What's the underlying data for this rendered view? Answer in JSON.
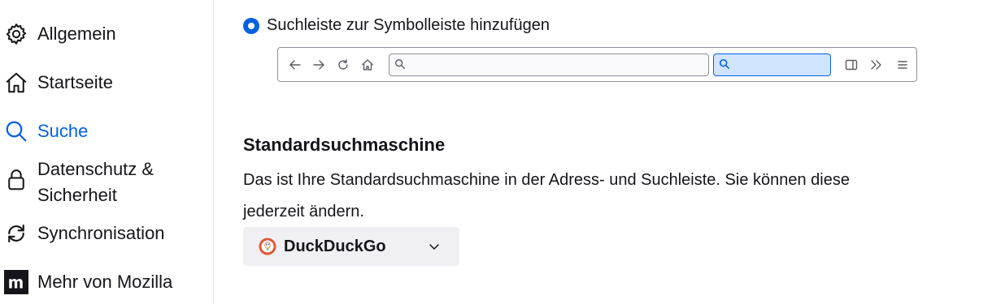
{
  "sidebar": {
    "items": [
      {
        "label": "Allgemein",
        "icon": "gear-icon"
      },
      {
        "label": "Startseite",
        "icon": "home-icon"
      },
      {
        "label": "Suche",
        "icon": "search-icon",
        "active": true
      },
      {
        "label": "Datenschutz &",
        "label2": "Sicherheit",
        "icon": "lock-icon"
      },
      {
        "label": "Synchronisation",
        "icon": "sync-icon"
      },
      {
        "label": "Mehr von Mozilla",
        "icon": "mozilla-icon"
      }
    ]
  },
  "main": {
    "radio_label": "Suchleiste zur Symbolleiste hinzufügen",
    "section_title": "Standardsuchmaschine",
    "description": "Das ist Ihre Standardsuchmaschine in der Adress- und Suchleiste. Sie können diese jederzeit ändern.",
    "engine": {
      "name": "DuckDuckGo",
      "icon": "duckduckgo-icon"
    }
  },
  "colors": {
    "accent": "#0061e0",
    "select_bg": "#f0f0f4",
    "searchbar_bg": "#cfe5ff"
  }
}
